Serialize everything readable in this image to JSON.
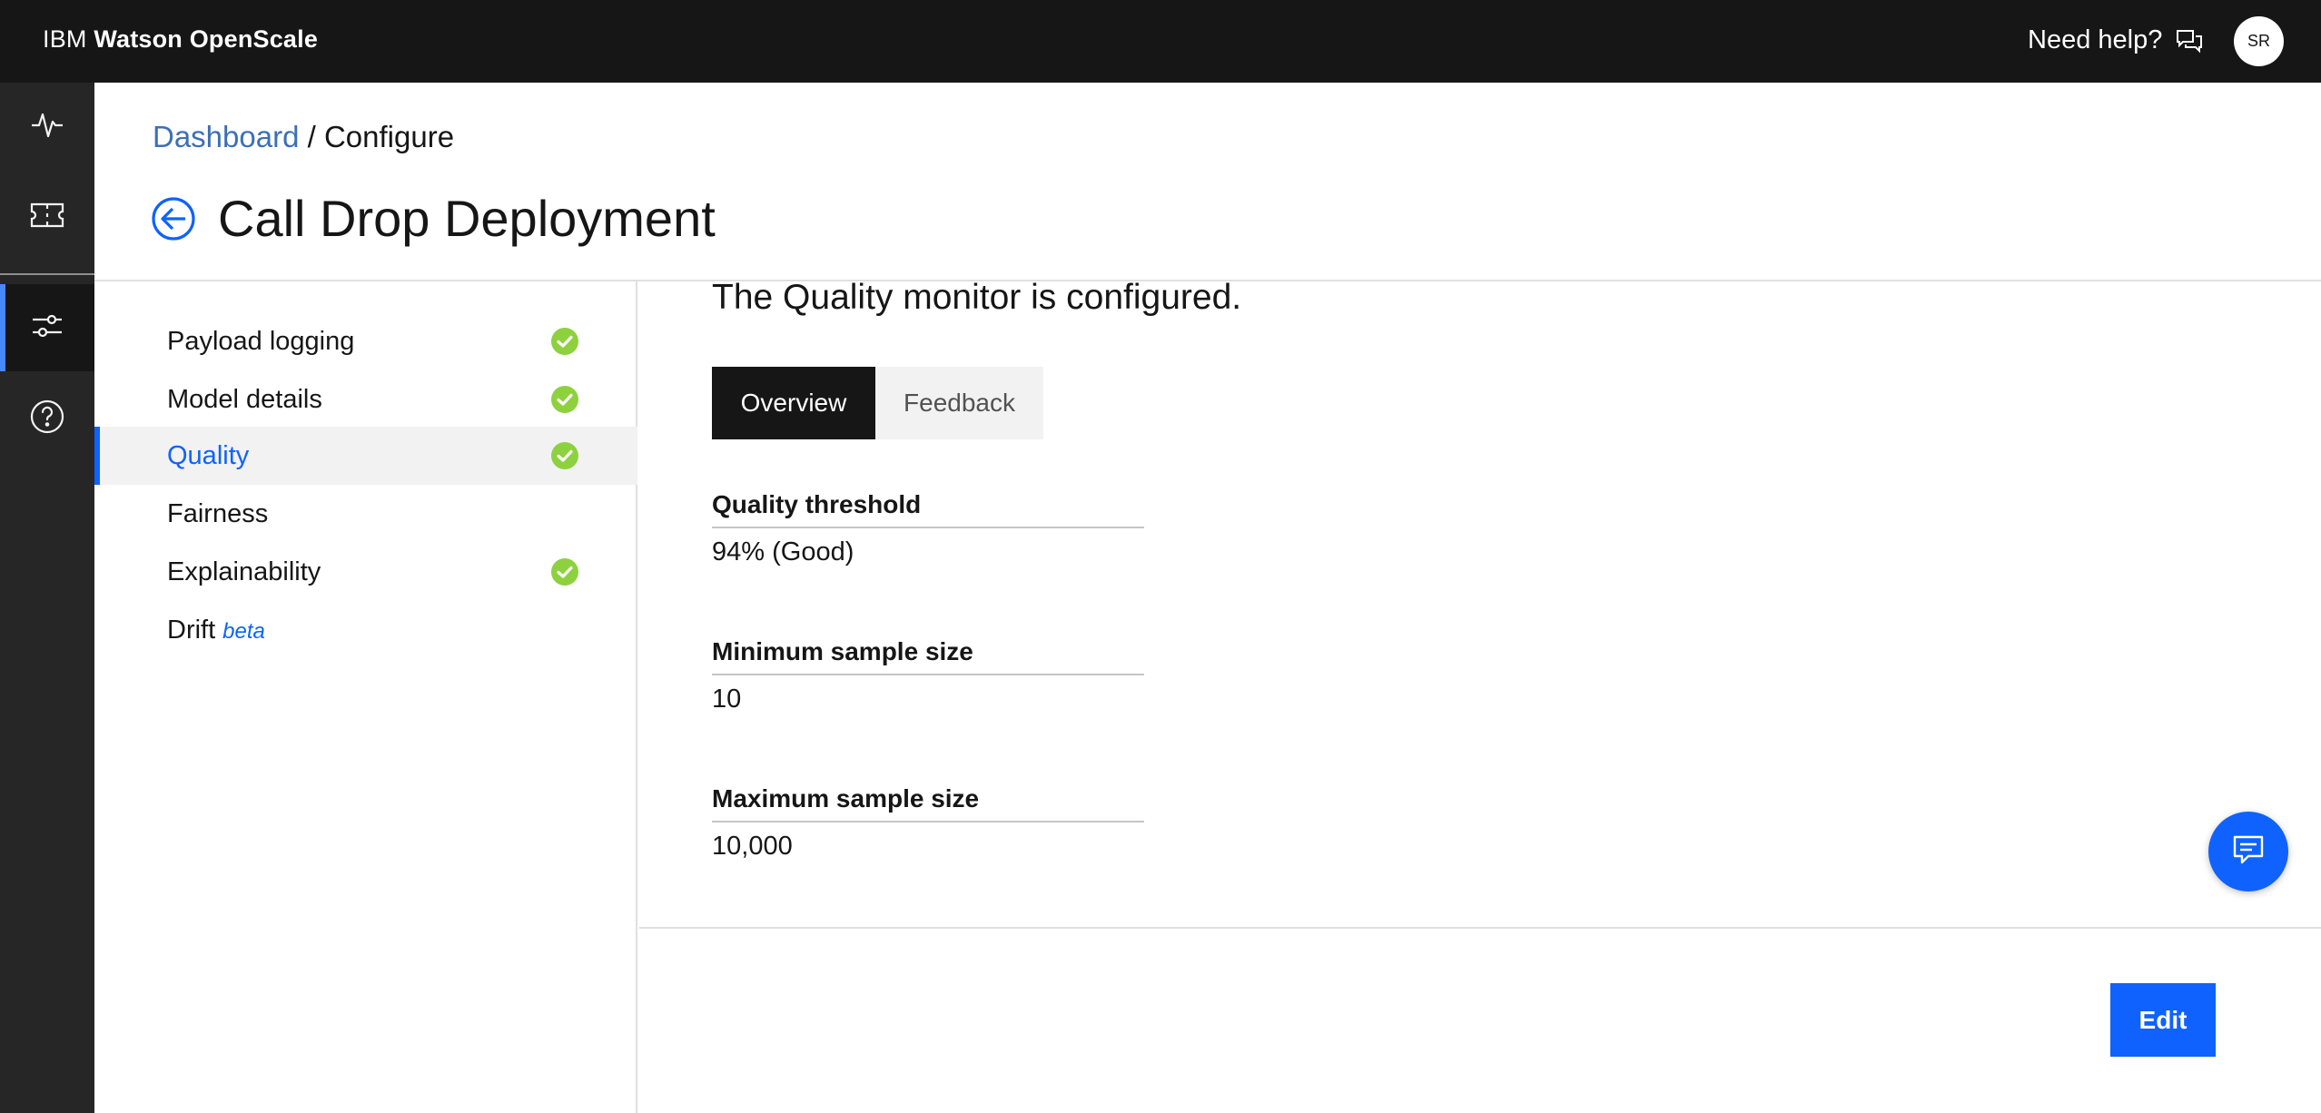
{
  "header": {
    "brand_prefix": "IBM ",
    "brand_name": "Watson OpenScale",
    "help_label": "Need help?",
    "avatar_initials": "SR"
  },
  "rail": {
    "items": [
      {
        "icon": "activity-icon"
      },
      {
        "icon": "ticket-icon"
      },
      {
        "icon": "sliders-icon",
        "active": true
      },
      {
        "icon": "help-circle-icon"
      }
    ]
  },
  "breadcrumb": {
    "link": "Dashboard",
    "separator": " / ",
    "current": "Configure"
  },
  "page": {
    "title": "Call Drop Deployment"
  },
  "sidenav": {
    "items": [
      {
        "label": "Payload logging",
        "checked": true
      },
      {
        "label": "Model details",
        "checked": true
      },
      {
        "label": "Quality",
        "checked": true,
        "active": true
      },
      {
        "label": "Fairness",
        "checked": false
      },
      {
        "label": "Explainability",
        "checked": true
      },
      {
        "label": "Drift",
        "badge": "beta",
        "checked": false
      }
    ]
  },
  "main": {
    "status": "The Quality monitor is configured.",
    "tabs": [
      {
        "label": "Overview",
        "selected": true
      },
      {
        "label": "Feedback",
        "selected": false
      }
    ],
    "fields": [
      {
        "label": "Quality threshold",
        "value": "94% (Good)"
      },
      {
        "label": "Minimum sample size",
        "value": "10"
      },
      {
        "label": "Maximum sample size",
        "value": "10,000"
      }
    ],
    "edit_label": "Edit"
  },
  "colors": {
    "accent": "#0f62fe",
    "success": "#8ed13f",
    "header_bg": "#161616",
    "rail_bg": "#262626"
  }
}
